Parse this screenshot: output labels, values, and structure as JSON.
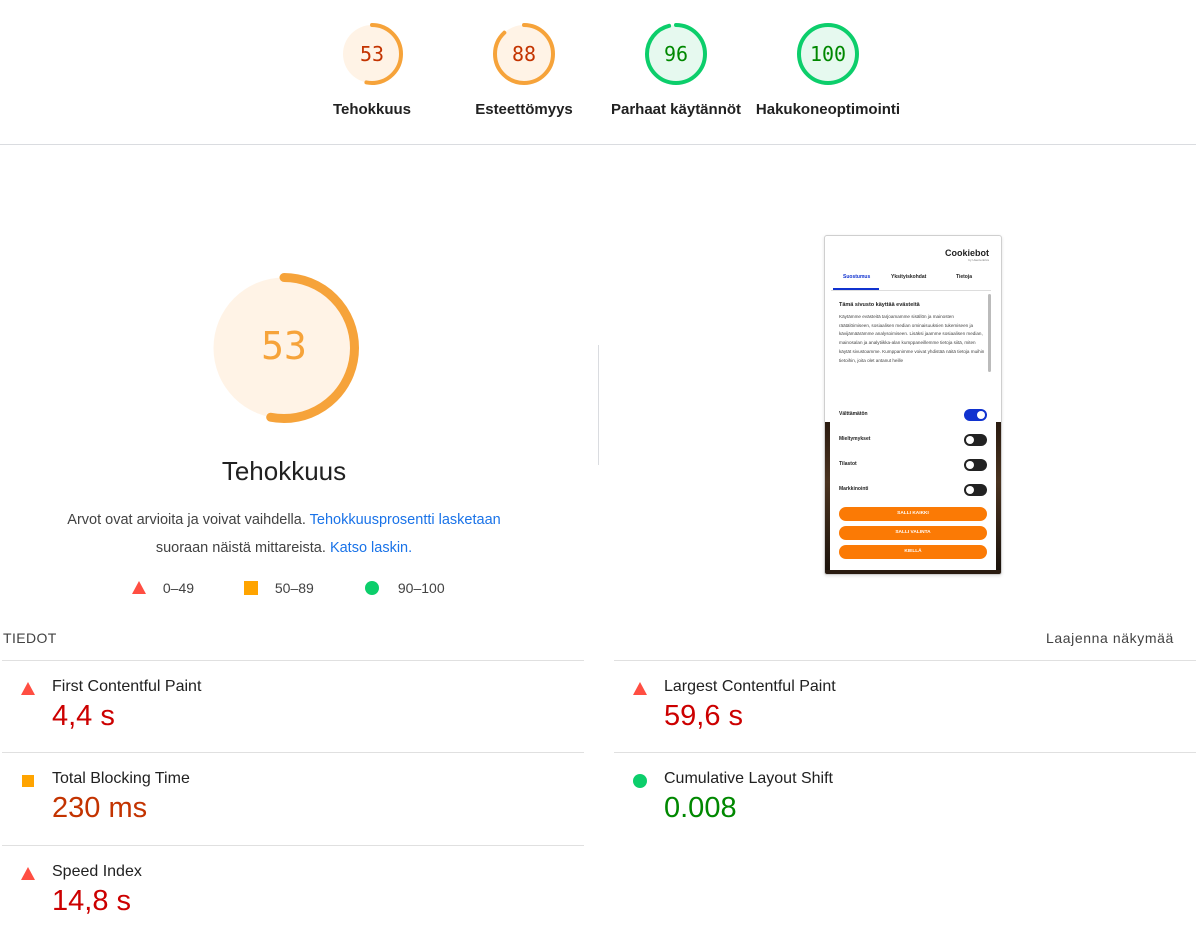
{
  "categories": [
    {
      "score": "53",
      "label": "Tehokkuus",
      "fraction": 0.53,
      "color": "#f6a33a",
      "fill": "#fff3e6"
    },
    {
      "score": "88",
      "label": "Esteettömyys",
      "fraction": 0.88,
      "color": "#f6a33a",
      "fill": "#fff3e6"
    },
    {
      "score": "96",
      "label": "Parhaat käytännöt",
      "fraction": 0.96,
      "color": "#0cce6b",
      "fill": "#e6f9ef"
    },
    {
      "score": "100",
      "label": "Hakukoneoptimointi",
      "fraction": 1.0,
      "color": "#0cce6b",
      "fill": "#e6f9ef"
    }
  ],
  "main": {
    "score": "53",
    "fraction": 0.53,
    "title": "Tehokkuus",
    "desc_text1": "Arvot ovat arvioita ja voivat vaihdella.",
    "desc_link1": "Tehokkuusprosentti lasketaan",
    "desc_text2": "suoraan näistä mittareista.",
    "desc_link2": "Katso laskin."
  },
  "legend": [
    {
      "range": "0–49",
      "icon": "triangle-red-icon",
      "color": "#ff4e42"
    },
    {
      "range": "50–89",
      "icon": "square-orange-icon",
      "color": "#ffa400"
    },
    {
      "range": "90–100",
      "icon": "circle-green-icon",
      "color": "#0cce6b"
    }
  ],
  "screenshot": {
    "logo": "Cookiebot",
    "logo_sub": "by Usercentrics",
    "tabs": [
      "Suostumus",
      "Yksityiskohdat",
      "Tietoja"
    ],
    "title": "Tämä sivusto käyttää evästeitä",
    "body": "Käytämme evästeitä tarjoamamme sisällön ja mainosten räätälöimiseen, sosiaalisen median ominaisuuksien tukemiseen ja kävijämäärämme analysoimiseen. Lisäksi jaamme sosiaalisen median, mainosalan ja analytiikka-alan kumppaneillemme tietoja siitä, miten käytät sivustoamme. Kumppanimme voivat yhdistää näitä tietoja muihin tietoihin, joita olet antanut heille",
    "toggles": [
      {
        "label": "Välttämätön",
        "on": true
      },
      {
        "label": "Mieltymykset",
        "on": false
      },
      {
        "label": "Tilastot",
        "on": false
      },
      {
        "label": "Markkinointi",
        "on": false
      }
    ],
    "buttons": [
      "SALLI KAIKKI",
      "SALLI VALINTA",
      "KIELLÄ"
    ]
  },
  "details": {
    "heading": "TIEDOT",
    "expand": "Laajenna näkymää"
  },
  "metrics": [
    {
      "label": "First Contentful Paint",
      "value": "4,4 s",
      "status": "red"
    },
    {
      "label": "Largest Contentful Paint",
      "value": "59,6 s",
      "status": "red"
    },
    {
      "label": "Total Blocking Time",
      "value": "230 ms",
      "status": "orange"
    },
    {
      "label": "Cumulative Layout Shift",
      "value": "0.008",
      "status": "green"
    },
    {
      "label": "Speed Index",
      "value": "14,8 s",
      "status": "red"
    }
  ]
}
